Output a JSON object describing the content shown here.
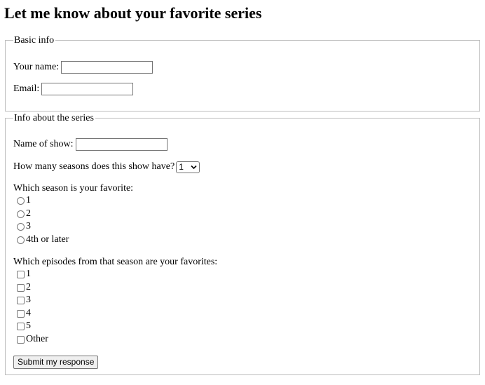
{
  "page": {
    "title": "Let me know about your favorite series"
  },
  "basic_info": {
    "legend": "Basic info",
    "name_label": "Your name:",
    "name_value": "",
    "email_label": "Email:",
    "email_value": ""
  },
  "series_info": {
    "legend": "Info about the series",
    "show_label": "Name of show:",
    "show_value": "",
    "seasons_label": "How many seasons does this show have?",
    "seasons_selected": "1",
    "favorite_season_label": "Which season is your favorite:",
    "season_options": [
      "1",
      "2",
      "3",
      "4th or later"
    ],
    "episodes_label": "Which episodes from that season are your favorites:",
    "episode_options": [
      "1",
      "2",
      "3",
      "4",
      "5",
      "Other"
    ]
  },
  "submit_label": "Submit my response"
}
